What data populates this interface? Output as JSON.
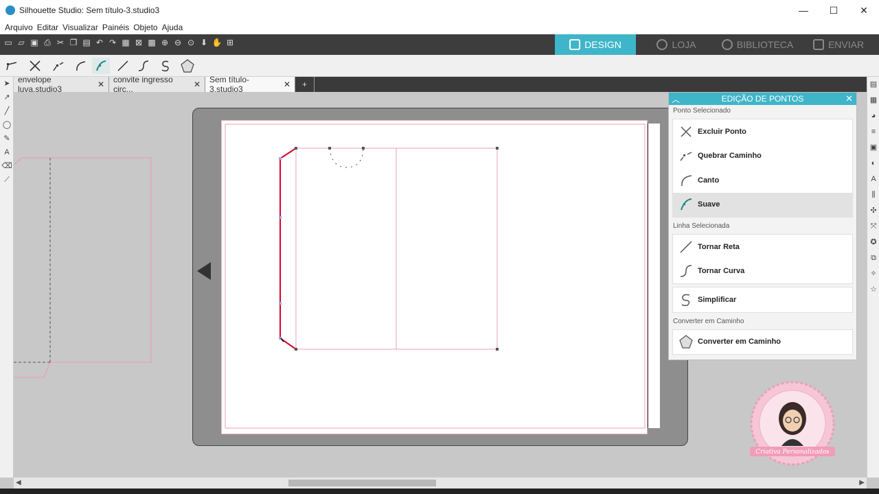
{
  "window": {
    "title": "Silhouette Studio: Sem título-3.studio3",
    "minimize": "—",
    "maximize": "☐",
    "close": "✕"
  },
  "menu": [
    "Arquivo",
    "Editar",
    "Visualizar",
    "Painéis",
    "Objeto",
    "Ajuda"
  ],
  "modes": [
    {
      "label": "DESIGN",
      "active": true
    },
    {
      "label": "LOJA",
      "active": false
    },
    {
      "label": "BIBLIOTECA",
      "active": false
    },
    {
      "label": "ENVIAR",
      "active": false
    }
  ],
  "tabs": [
    {
      "label": "envelope luva.studio3",
      "close": "✕"
    },
    {
      "label": "convite ingresso circ...",
      "close": "✕"
    },
    {
      "label": "Sem título-3.studio3",
      "close": "✕"
    }
  ],
  "new_tab": "+",
  "panel": {
    "title": "EDIÇÃO DE PONTOS",
    "section_point": "Ponto Selecionado",
    "section_line": "Linha Selecionada",
    "section_convert": "Converter em Caminho",
    "items": {
      "excluir": "Excluir Ponto",
      "quebrar": "Quebrar Caminho",
      "canto": "Canto",
      "suave": "Suave",
      "reta": "Tornar Reta",
      "curva": "Tornar Curva",
      "simplificar": "Simplificar",
      "converter": "Converter em Caminho"
    },
    "selected_item": "Suave"
  },
  "watermark": {
    "text": "Criativa Personalizados"
  },
  "colors": {
    "accent": "#3fb5c9",
    "cut_line": "#e8a0b4",
    "selected_path": "#d6002a",
    "mat": "#8e8e8e"
  }
}
